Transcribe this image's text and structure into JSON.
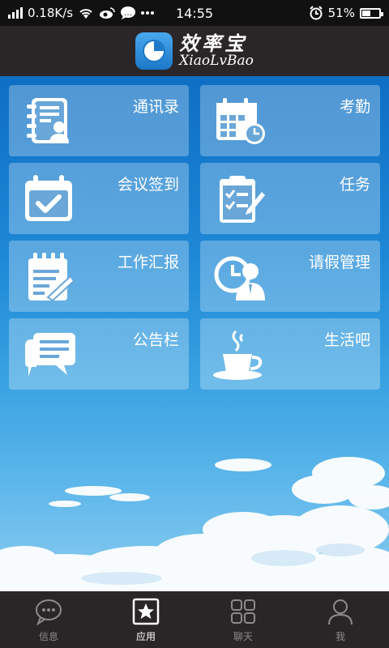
{
  "status_bar": {
    "net_speed": "0.18K/s",
    "time": "14:55",
    "battery_text": "51%",
    "battery_level": 0.51,
    "icons": [
      "signal-icon",
      "wifi-icon",
      "weibo-icon",
      "chat-bubble-icon",
      "more-dots-icon",
      "alarm-icon",
      "battery-icon"
    ]
  },
  "header": {
    "title_cn": "效率宝",
    "title_en": "XiaoLvBao"
  },
  "tiles": [
    {
      "label": "通讯录",
      "icon": "contacts-icon"
    },
    {
      "label": "考勤",
      "icon": "calendar-clock-icon"
    },
    {
      "label": "会议签到",
      "icon": "calendar-check-icon"
    },
    {
      "label": "任务",
      "icon": "clipboard-task-icon"
    },
    {
      "label": "工作汇报",
      "icon": "notepad-pen-icon"
    },
    {
      "label": "请假管理",
      "icon": "person-clock-icon"
    },
    {
      "label": "公告栏",
      "icon": "message-bubbles-icon"
    },
    {
      "label": "生活吧",
      "icon": "coffee-cup-icon"
    }
  ],
  "bottom_nav": {
    "items": [
      {
        "label": "信息",
        "icon": "message-icon",
        "active": false
      },
      {
        "label": "应用",
        "icon": "star-icon",
        "active": true
      },
      {
        "label": "聊天",
        "icon": "grid-icon",
        "active": false
      },
      {
        "label": "我",
        "icon": "user-icon",
        "active": false
      }
    ]
  },
  "colors": {
    "header_bg": "#2a2628",
    "accent": "#1c78c8",
    "tile_bg": "rgba(255,255,255,0.28)"
  }
}
